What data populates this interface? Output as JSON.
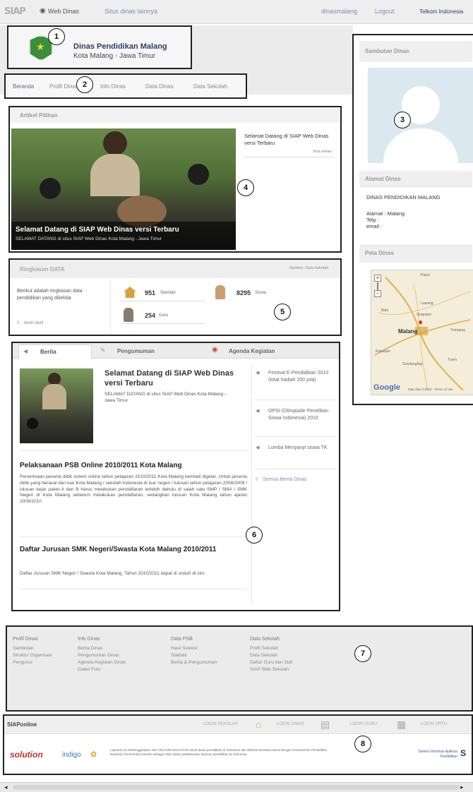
{
  "topbar": {
    "logo": "SIAP",
    "web_dinas": "Web Dinas",
    "situs_lain": "Situs dinas lainnya",
    "user": "dinasmalang",
    "logout": "Logout",
    "telkom": "Telkom Indonesia"
  },
  "header": {
    "name": "Dinas Pendidikan Malang",
    "location": "Kota Malang - Jawa Timur"
  },
  "nav": [
    "Beranda",
    "Profil Dinas",
    "Info Dinas",
    "Data Dinas",
    "Data Sekolah"
  ],
  "sambutan": {
    "title": "Sambutan Dinas"
  },
  "alamat": {
    "title": "Alamat Dinas",
    "name": "DINAS PENDIDIKAN MALANG",
    "alamat": "Alamat : Malang",
    "telp": "Telp :",
    "email": "email :"
  },
  "peta": {
    "title": "Peta Dinas",
    "labels": [
      "Malang",
      "Pujon",
      "Batu",
      "Lawang",
      "Singosari",
      "Turen",
      "Kepanjen",
      "Gondanglegi",
      "Tumpang"
    ],
    "google": "Google",
    "terms": "Map data ©2010 - Terms of Use"
  },
  "artikel": {
    "title": "Artikel Pilihan",
    "caption_title": "Selamat Datang di SIAP Web Dinas versi Terbaru",
    "caption_sub": "SELAMAT DATANG di situs SIAP Web Dinas Kota Malang - Jawa Timur",
    "side_title": "Selamat Datang di SIAP Web Dinas versi Terbaru",
    "side_more": "lihat sekilas"
  },
  "ringkasan": {
    "title": "Ringkasan DATA",
    "sumber": "Sumber: Data Sekolah",
    "desc": "Berikut adalah ringkasan data pendidikan yang dikelola",
    "more": "lebih detil",
    "stats": [
      {
        "value": "951",
        "label": "Sekolah"
      },
      {
        "value": "8295",
        "label": "Siswa"
      },
      {
        "value": "254",
        "label": "Guru"
      }
    ]
  },
  "news": {
    "tabs": [
      "Berita",
      "Pengumuman",
      "Agenda Kegiatan"
    ],
    "featured_title": "Selamat Datang di SIAP Web Dinas versi Terbaru",
    "featured_text": "SELAMAT DATANG di situs SIAP Web Dinas Kota Malang – Jawa Timur.",
    "article2_title": "Pelaksanaan PSB Online 2010/2011 Kota Malang",
    "article2_text": "Penerimaan peserta didik sistem online tahun pelajaran 2010/2011 Kota Malang kembali digelar. Untuk peserta didik yang berasal dari luar Kota Malang / sekolah Indonesia di luar negeri / lulusan tahun pelajaran 2008/2009 / lulusan kejar paket A dan B harus melakukan pendaftaran terlebih dahulu di salah satu SMP / SMA / SMK Negeri di Kota Malang sebelum melakukan pendaftaran, sedangkan lulusan Kota Malang tahun ajaran 2009/2010",
    "article3_title": "Daftar Jurusan SMK Negeri/Swasta Kota Malang 2010/2011",
    "article3_text": "Daftar Jurusan SMK Negeri / Swasta Kota Malang. Tahun 2010/2011 dapat di unduh di sini.",
    "side": [
      "Festival E-Pendidikan 2010 (total hadiah 200 juta)",
      "OPSI (Olimpiade Penelitian Siswa Indonesia) 2010",
      "Lomba Menyanyi siswa TK"
    ],
    "semua": "Semua Berita Dinas"
  },
  "footer": {
    "cols": [
      {
        "title": "Profil Dinas",
        "items": [
          "Sambutan",
          "Struktur Organisasi",
          "Pengurus"
        ]
      },
      {
        "title": "Info Dinas",
        "items": [
          "Berita Dinas",
          "Pengumuman Dinas",
          "Agenda Kegiatan Dinas",
          "Galeri Foto"
        ]
      },
      {
        "title": "Data PSB",
        "items": [
          "Hasil Seleksi",
          "Statistik",
          "Berita & Pengumuman"
        ]
      },
      {
        "title": "Data Sekolah",
        "items": [
          "Profil Sekolah",
          "Data Sekolah",
          "Daftar Guru dan Staf",
          "SIAP Web Sekolah"
        ]
      }
    ]
  },
  "bottom": {
    "logo": "SIAPonline",
    "logins": [
      "LOGIN SEKOLAH",
      "LOGIN DINAS",
      "LOGIN GURU",
      "LOGIN ORTU"
    ],
    "solution": "solution",
    "indigo": "indigo",
    "desc": "Layanan ini diselenggarakan oleh TELKOM SOLUTION untuk dunia pendidikan di Indonesia dan dikelola bersama-sama dengan Kementerian Pendidikan Nasional, Pemerintah Daerah sebagai mitra dalam pelaksanaan layanan pendidikan di Indonesia.",
    "right": "Sistem Informasi Aplikasi Pendidikan"
  },
  "markers": [
    "1",
    "2",
    "3",
    "4",
    "5",
    "6",
    "7",
    "8"
  ]
}
